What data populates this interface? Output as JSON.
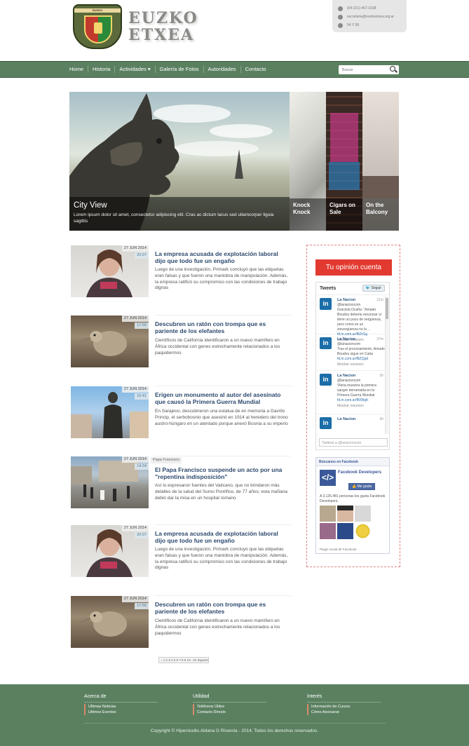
{
  "header": {
    "crest_band_text": "EUZKO",
    "logo_line1": "EUZKO",
    "logo_line2": "ETXEA",
    "contact": [
      {
        "icon": "phone-icon",
        "text": "(54-221) 457-1638"
      },
      {
        "icon": "mail-icon",
        "text": "secretaria@euzkoetxea.org.ar"
      },
      {
        "icon": "home-icon",
        "text": "54 Y 58"
      }
    ]
  },
  "nav": {
    "items": [
      "Home",
      "Historia",
      "Actividades ▾",
      "Galería de Fotos",
      "Autoridades",
      "Contacto"
    ],
    "search_placeholder": "Buscar"
  },
  "slider": {
    "main_title": "City View",
    "main_desc": "Lorem ipsum dolor sit amet, consectetur adipiscing elit. Cras ac dictum lacus sed ullamcorper ligula sagittis",
    "thumbs": [
      "Knock Knock",
      "Cigars on Sale",
      "On the Balcony"
    ]
  },
  "articles": [
    {
      "date": "27 JUN 2014",
      "time": "20:07",
      "tag": "",
      "title": "La empresa acusada de explotación laboral dijo que todo fue un engaño",
      "text": "Luego de una investigación, Primark concluyó que las etiquetas eran falsas y que fueron una maniobra de manipulación. Además, la empresa ratificó su compromiso con las condiciones de trabajo dignas"
    },
    {
      "date": "27 JUN 2014",
      "time": "17:50",
      "tag": "",
      "title": "Descubren un ratón con trompa que es pariente de los elefantes",
      "text": "Científicos de California identificaron a un nuevo mamífero en África occidental con genes estrechamente relacionados a los paquidermos"
    },
    {
      "date": "27 JUN 2014",
      "time": "16:41",
      "tag": "",
      "title": "Erigen un monumento al autor del asesinato que causó la Primera Guerra Mundial",
      "text": "En Sarajevo, descubrieron una estatua de en memoria a Gavrilo Princip, el serbobosnio que asesinó en 1914 al heredero del trono austro-húngaro en un atentado porque anexó Bosnia a su imperio"
    },
    {
      "date": "27 JUN 2014",
      "time": "14:34",
      "tag": "Papa Francisco",
      "title": "El Papa Francisco suspende un acto por una \"repentina indisposición\"",
      "text": "Así lo expresaron fuentes del Vaticano, que no brindaron más detalles de la salud del Sumo Pontífice, de 77 años; esta mañana debió dar la misa en un hospital romano"
    },
    {
      "date": "27 JUN 2014",
      "time": "20:07",
      "tag": "",
      "title": "La empresa acusada de explotación laboral dijo que todo fue un engaño",
      "text": "Luego de una investigación, Primark concluyó que las etiquetas eran falsas y que fueron una maniobra de manipulación. Además, la empresa ratificó su compromiso con las condiciones de trabajo dignas"
    },
    {
      "date": "27 JUN 2014",
      "time": "17:50",
      "tag": "",
      "title": "Descubren un ratón con trompa que es pariente de los elefantes",
      "text": "Científicos de California identificaron a un nuevo mamífero en África occidental con genes estrechamente relacionados a los paquidermos"
    }
  ],
  "pagination": "‹ 1 2 3 4 5 6 7 8 9 10...22 Siguiente ›",
  "sidebar": {
    "opinion_button": "Tu opinión cuenta",
    "tweets_title": "Tweets",
    "follow_label": "Seguir",
    "tweets": [
      {
        "name": "La Nacion",
        "handle": "@lanacioncom",
        "time": "21m",
        "text": "Graciela Ocaña: \"Amado Boudou debería renunciar si tiene un poco de vergüenza, pero como es un sinvergüenza no lo...",
        "link": "fd.in.com.ar/f8ZrGg",
        "summary": "Mostrar resumen"
      },
      {
        "name": "La Nacion",
        "handle": "@lanacioncom",
        "time": "37m",
        "text": "Tras el procesamiento, Amado Boudou sigue en Cuba",
        "link": "fd.in.com.ar/f8ZQpd",
        "summary": "Mostrar resumen"
      },
      {
        "name": "La Nacion",
        "handle": "@lanacioncom",
        "time": "3h",
        "text": "Vlena muestra la primera sangre derramada en la Primera Guerra Mundial",
        "link": "fd.in.com.ar/f8XBgK",
        "summary": "Mostrar resumen"
      },
      {
        "name": "La Nacion",
        "handle": "",
        "time": "3h",
        "text": "",
        "link": "",
        "summary": ""
      }
    ],
    "tweet_reply_placeholder": "Twittear a @lanacioncom",
    "fb_header": "Búscanos en Facebook",
    "fb_name": "Facebook Developers",
    "fb_like": "Me gusta",
    "fb_count": "A 3.126.481 personas les gusta Facebook Developers.",
    "fb_footer": "Plugin social de Facebook"
  },
  "footer": {
    "columns": [
      {
        "title": "Acerca de",
        "links": [
          "Ultimas Noticias",
          "Ultimos Eventos"
        ]
      },
      {
        "title": "Utilidad",
        "links": [
          "Teléfonos Útiles",
          "Contacto Directo"
        ]
      },
      {
        "title": "Interés",
        "links": [
          "Información de Cursos",
          "Cómo Asociarse"
        ]
      }
    ],
    "copyright": "Copyright © Hiperstudio.Aldana G Rivarola - 2014. Todos los derechos reservados."
  },
  "colors": {
    "nav_green": "#5a8060",
    "title_blue": "#2d4a6e",
    "opinion_red": "#e23a30",
    "sidebar_border": "#e08080"
  }
}
